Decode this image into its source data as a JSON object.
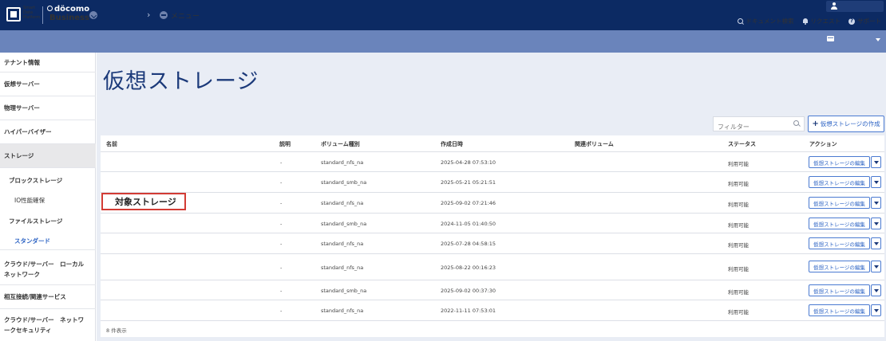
{
  "header": {
    "logo_text": [
      "Smart",
      "Data",
      "Platform"
    ],
    "brand_top": "döcomo",
    "brand_bottom": "Business",
    "breadcrumb_label": "メニュー",
    "links": [
      {
        "label": "ドキュメント検索",
        "icon": "search-icon"
      },
      {
        "label": "リクエスト",
        "icon": "bell-icon"
      },
      {
        "label": "サポート",
        "icon": "help-icon"
      }
    ]
  },
  "sidebar": {
    "items": [
      {
        "label": "テナント情報"
      },
      {
        "label": "仮想サーバー"
      },
      {
        "label": "物理サーバー"
      },
      {
        "label": "ハイパーバイザー"
      },
      {
        "label": "ストレージ"
      },
      {
        "label": "ブロックストレージ"
      },
      {
        "label": "IO性能確保"
      },
      {
        "label": "ファイルストレージ"
      },
      {
        "label": "スタンダード"
      },
      {
        "label": "クラウド/サーバー　ローカルネットワーク"
      },
      {
        "label": "相互接続/関連サービス"
      },
      {
        "label": "クラウド/サーバー　ネットワークセキュリティ"
      }
    ]
  },
  "page": {
    "title": "仮想ストレージ",
    "filter_placeholder": "フィルター",
    "create_label": "仮想ストレージの作成",
    "count_label": "8 件表示",
    "highlight_label": "対象ストレージ"
  },
  "table": {
    "headers": [
      "名前",
      "説明",
      "ボリューム種別",
      "作成日時",
      "関連ボリューム",
      "ステータス",
      "アクション"
    ],
    "rows": [
      {
        "desc": "-",
        "type": "standard_nfs_na",
        "created": "2025-04-28 07:53:10",
        "status": "利用可能",
        "action": "仮想ストレージの編集"
      },
      {
        "desc": "-",
        "type": "standard_smb_na",
        "created": "2025-05-21 05:21:51",
        "status": "利用可能",
        "action": "仮想ストレージの編集"
      },
      {
        "desc": "-",
        "type": "standard_nfs_na",
        "created": "2025-09-02 07:21:46",
        "status": "利用可能",
        "action": "仮想ストレージの編集"
      },
      {
        "desc": "-",
        "type": "standard_smb_na",
        "created": "2024-11-05 01:40:50",
        "status": "利用可能",
        "action": "仮想ストレージの編集"
      },
      {
        "desc": "-",
        "type": "standard_nfs_na",
        "created": "2025-07-28 04:58:15",
        "status": "利用可能",
        "action": "仮想ストレージの編集"
      },
      {
        "desc": "-",
        "type": "standard_nfs_na",
        "created": "2025-08-22 00:16:23",
        "status": "利用可能",
        "action": "仮想ストレージの編集"
      },
      {
        "desc": "-",
        "type": "standard_smb_na",
        "created": "2025-09-02 00:37:30",
        "status": "利用可能",
        "action": "仮想ストレージの編集"
      },
      {
        "desc": "-",
        "type": "standard_nfs_na",
        "created": "2022-11-11 07:53:01",
        "status": "利用可能",
        "action": "仮想ストレージの編集"
      }
    ]
  }
}
